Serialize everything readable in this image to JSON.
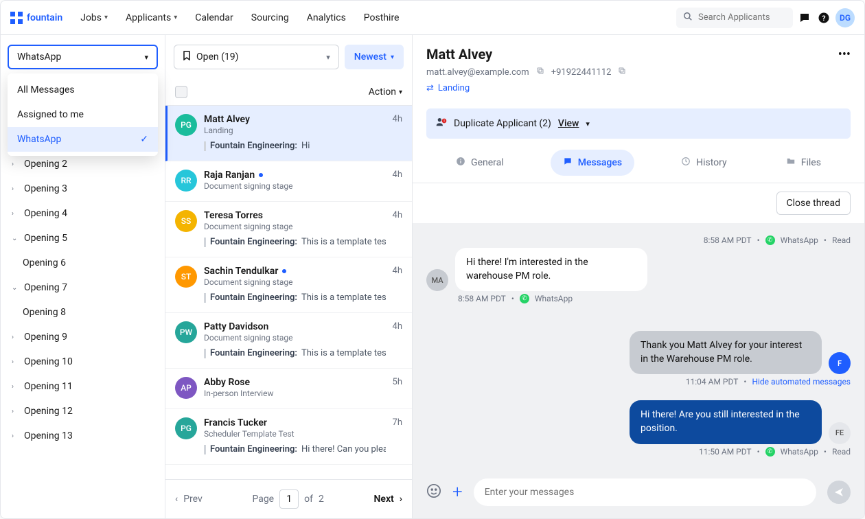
{
  "brand": "fountain",
  "nav": {
    "items": [
      "Jobs",
      "Applicants",
      "Calendar",
      "Sourcing",
      "Analytics",
      "Posthire"
    ],
    "search_placeholder": "Search Applicants",
    "user_initials": "DG"
  },
  "left": {
    "selected_filter": "WhatsApp",
    "dropdown_options": [
      "All Messages",
      "Assigned to me",
      "WhatsApp"
    ],
    "openings": [
      {
        "label": "Opening 2",
        "chev": ">",
        "indent": false
      },
      {
        "label": "Opening 3",
        "chev": ">",
        "indent": false
      },
      {
        "label": "Opening 4",
        "chev": ">",
        "indent": false
      },
      {
        "label": "Opening 5",
        "chev": "v",
        "indent": false
      },
      {
        "label": "Opening 6",
        "chev": "",
        "indent": true
      },
      {
        "label": "Opening 7",
        "chev": "v",
        "indent": false
      },
      {
        "label": "Opening 8",
        "chev": "",
        "indent": true
      },
      {
        "label": "Opening 9",
        "chev": ">",
        "indent": false
      },
      {
        "label": "Opening 10",
        "chev": ">",
        "indent": false
      },
      {
        "label": "Opening 11",
        "chev": ">",
        "indent": false
      },
      {
        "label": "Opening 12",
        "chev": ">",
        "indent": false
      },
      {
        "label": "Opening 13",
        "chev": ">",
        "indent": false
      }
    ]
  },
  "mid": {
    "open_label": "Open (19)",
    "sort_label": "Newest",
    "action_label": "Action",
    "messages": [
      {
        "initials": "PG",
        "color": "#1abc9c",
        "name": "Matt Alvey",
        "stage": "Landing",
        "from": "Fountain Engineering:",
        "body": "Hi",
        "time": "4h",
        "new": false,
        "sel": true
      },
      {
        "initials": "RR",
        "color": "#26c6da",
        "name": "Raja Ranjan",
        "stage": "Document signing stage",
        "from": "",
        "body": "",
        "time": "4h",
        "new": true,
        "sel": false
      },
      {
        "initials": "SS",
        "color": "#f4b400",
        "name": "Teresa Torres",
        "stage": "Document signing stage",
        "from": "Fountain Engineering:",
        "body": "This is a template test",
        "time": "4h",
        "new": false,
        "sel": false
      },
      {
        "initials": "ST",
        "color": "#ff9800",
        "name": "Sachin Tendulkar",
        "stage": "Document signing stage",
        "from": "Fountain Engineering:",
        "body": "This is a template test",
        "time": "4h",
        "new": true,
        "sel": false
      },
      {
        "initials": "PW",
        "color": "#26a69a",
        "name": "Patty Davidson",
        "stage": "Document signing stage",
        "from": "Fountain Engineering:",
        "body": "This is a template test",
        "time": "4h",
        "new": false,
        "sel": false
      },
      {
        "initials": "AP",
        "color": "#7e57c2",
        "name": "Abby Rose",
        "stage": "In-person Interview",
        "from": "",
        "body": "",
        "time": "5h",
        "new": false,
        "sel": false
      },
      {
        "initials": "PG",
        "color": "#26a69a",
        "name": "Francis Tucker",
        "stage": "Scheduler Template Test",
        "from": "Fountain Engineering:",
        "body": "Hi there! Can you please send...",
        "time": "7h",
        "new": false,
        "sel": false
      }
    ],
    "pager": {
      "prev": "Prev",
      "page_label": "Page",
      "current": "1",
      "of_label": "of",
      "total": "2",
      "next": "Next"
    }
  },
  "right": {
    "name": "Matt Alvey",
    "email": "matt.alvey@example.com",
    "phone": "+91922441112",
    "landing_label": "Landing",
    "duplicate_label": "Duplicate Applicant (2)",
    "view_label": "View",
    "tabs": {
      "general": "General",
      "messages": "Messages",
      "history": "History",
      "files": "Files"
    },
    "close_thread": "Close thread",
    "meta_top": {
      "time": "8:58 AM PDT",
      "channel": "WhatsApp",
      "status": "Read"
    },
    "msg_in": "Hi there!  I'm interested in the warehouse PM role.",
    "meta_in": {
      "time": "8:58 AM PDT",
      "channel": "WhatsApp"
    },
    "msg_auto": "Thank you Matt Alvey for your interest in the Warehouse PM role.",
    "meta_auto": {
      "time": "11:04 AM PDT",
      "hide": "Hide automated messages"
    },
    "msg_out": "Hi there! Are you still interested in the position.",
    "meta_out": {
      "time": "11:50 AM PDT",
      "channel": "WhatsApp",
      "status": "Read"
    },
    "avatar_in": "MA",
    "avatar_f": "F",
    "avatar_fe": "FE",
    "compose_placeholder": "Enter your messages"
  }
}
